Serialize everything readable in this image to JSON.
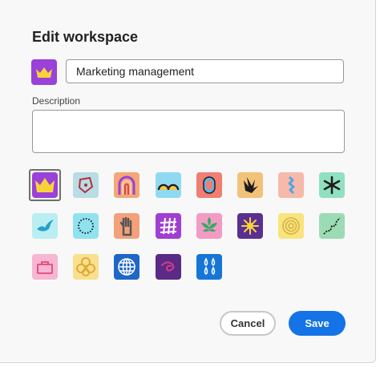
{
  "dialog": {
    "title": "Edit workspace",
    "name_value": "Marketing management",
    "description_label": "Description",
    "description_value": "",
    "cancel_label": "Cancel",
    "save_label": "Save",
    "selected_icon": "crown-icon"
  },
  "colors": {
    "accent": "#1473e6",
    "selected_border": "#6e6e6e"
  },
  "icons": [
    {
      "name": "crown-icon",
      "bg": "#9b40d8"
    },
    {
      "name": "shield-shape-icon",
      "bg": "#b8dde4"
    },
    {
      "name": "arch-icon",
      "bg": "#f3a875"
    },
    {
      "name": "hills-icon",
      "bg": "#8fdaf2"
    },
    {
      "name": "pool-icon",
      "bg": "#f07e72"
    },
    {
      "name": "leaf-splat-icon",
      "bg": "#f3c279"
    },
    {
      "name": "squiggle-icon",
      "bg": "#f7b9aa"
    },
    {
      "name": "asterisk-icon",
      "bg": "#8fe1bf"
    },
    {
      "name": "bird-icon",
      "bg": "#b9eef2"
    },
    {
      "name": "dotted-circle-icon",
      "bg": "#8fe3f0"
    },
    {
      "name": "hand-icon",
      "bg": "#f4a07a"
    },
    {
      "name": "grid-icon",
      "bg": "#a13fd1"
    },
    {
      "name": "plant-icon",
      "bg": "#f49bc4"
    },
    {
      "name": "sunburst-icon",
      "bg": "#5b2f91"
    },
    {
      "name": "spiral-icon",
      "bg": "#f9e47c"
    },
    {
      "name": "dotted-line-icon",
      "bg": "#9bdcb5"
    },
    {
      "name": "bag-icon",
      "bg": "#f6b6d4"
    },
    {
      "name": "flower-icon",
      "bg": "#f9e08e"
    },
    {
      "name": "globe-icon",
      "bg": "#1e67c8"
    },
    {
      "name": "swirl-icon",
      "bg": "#5a2a86"
    },
    {
      "name": "drops-icon",
      "bg": "#1576d8"
    }
  ]
}
